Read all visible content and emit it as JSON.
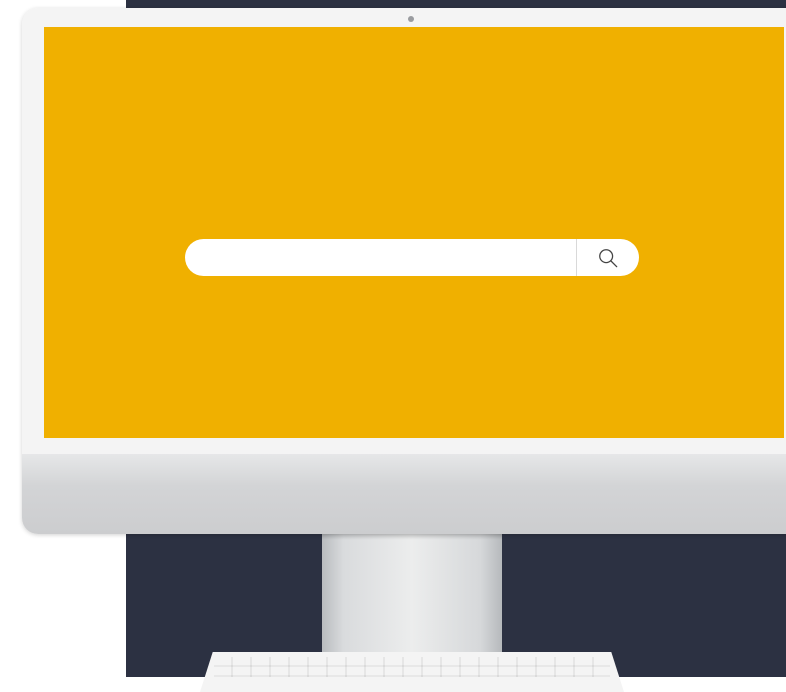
{
  "search": {
    "placeholder": "",
    "value": "",
    "icon": "search-icon"
  },
  "colors": {
    "screen": "#f0b000",
    "backdrop": "#2c3142",
    "search_bar": "#ffffff",
    "device": "#f4f4f4"
  }
}
